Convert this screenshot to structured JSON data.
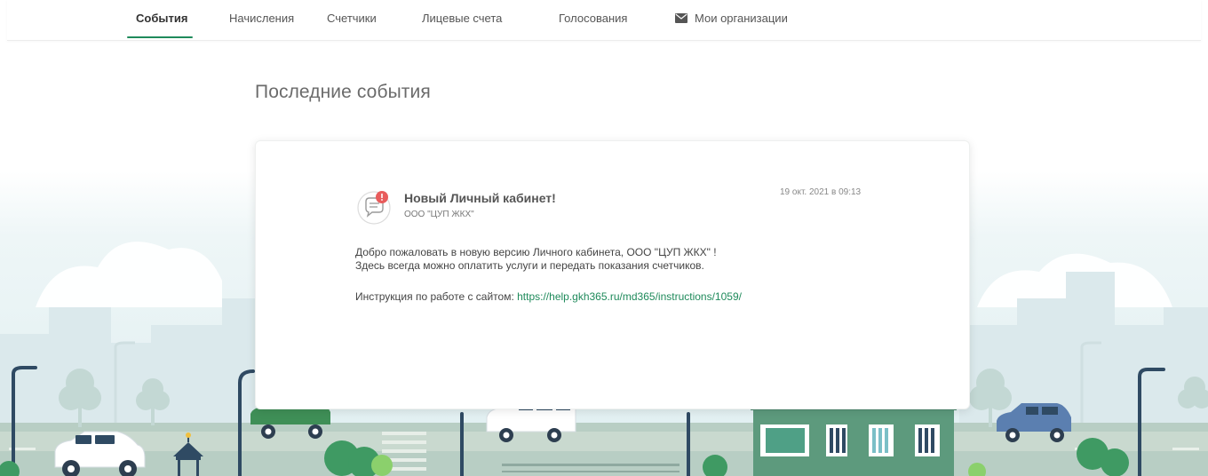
{
  "nav": {
    "items": [
      {
        "label": "События",
        "active": true
      },
      {
        "label": "Начисления",
        "active": false
      },
      {
        "label": "Счетчики",
        "active": false
      },
      {
        "label": "Лицевые счета",
        "active": false
      },
      {
        "label": "Голосования",
        "active": false
      },
      {
        "label": "Мои организации",
        "active": false,
        "icon": "mail-icon"
      }
    ]
  },
  "page": {
    "title": "Последние события"
  },
  "event": {
    "icon": "chat-notification-icon",
    "title": "Новый Личный кабинет!",
    "org": "ООО \"ЦУП ЖКХ\"",
    "date": "19 окт. 2021 в 09:13",
    "body_line1": "Добро пожаловать в новую версию Личного кабинета, ООО \"ЦУП ЖКХ\" !",
    "body_line2": "Здесь всегда можно оплатить услуги и передать показания счетчиков.",
    "instructions_label": "Инструкция по работе с сайтом:",
    "instructions_link": "https://help.gkh365.ru/md365/instructions/1059/"
  },
  "colors": {
    "accent": "#1f8a5b",
    "alert": "#e85c5c"
  }
}
